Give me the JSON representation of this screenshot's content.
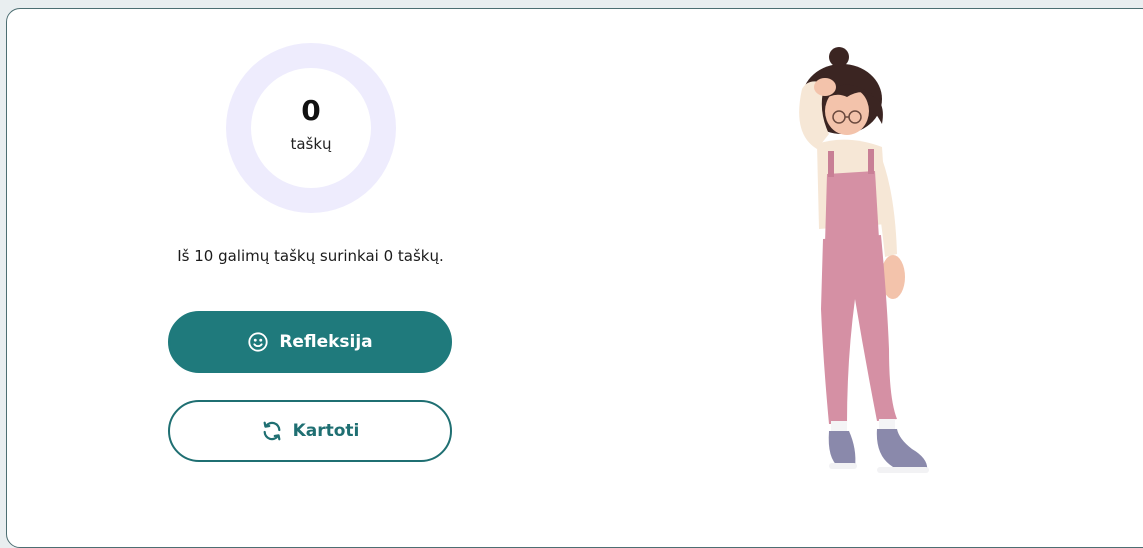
{
  "score": {
    "value": "0",
    "unit": "taškų"
  },
  "summary": "Iš 10 galimų taškų surinkai 0 taškų.",
  "buttons": {
    "reflection_label": "Refleksija",
    "repeat_label": "Kartoti"
  },
  "icons": {
    "reflection": "smiley-icon",
    "repeat": "refresh-icon"
  },
  "colors": {
    "primary": "#1f7a7c",
    "ring": "#eeecfd",
    "border": "#4d6e72"
  }
}
